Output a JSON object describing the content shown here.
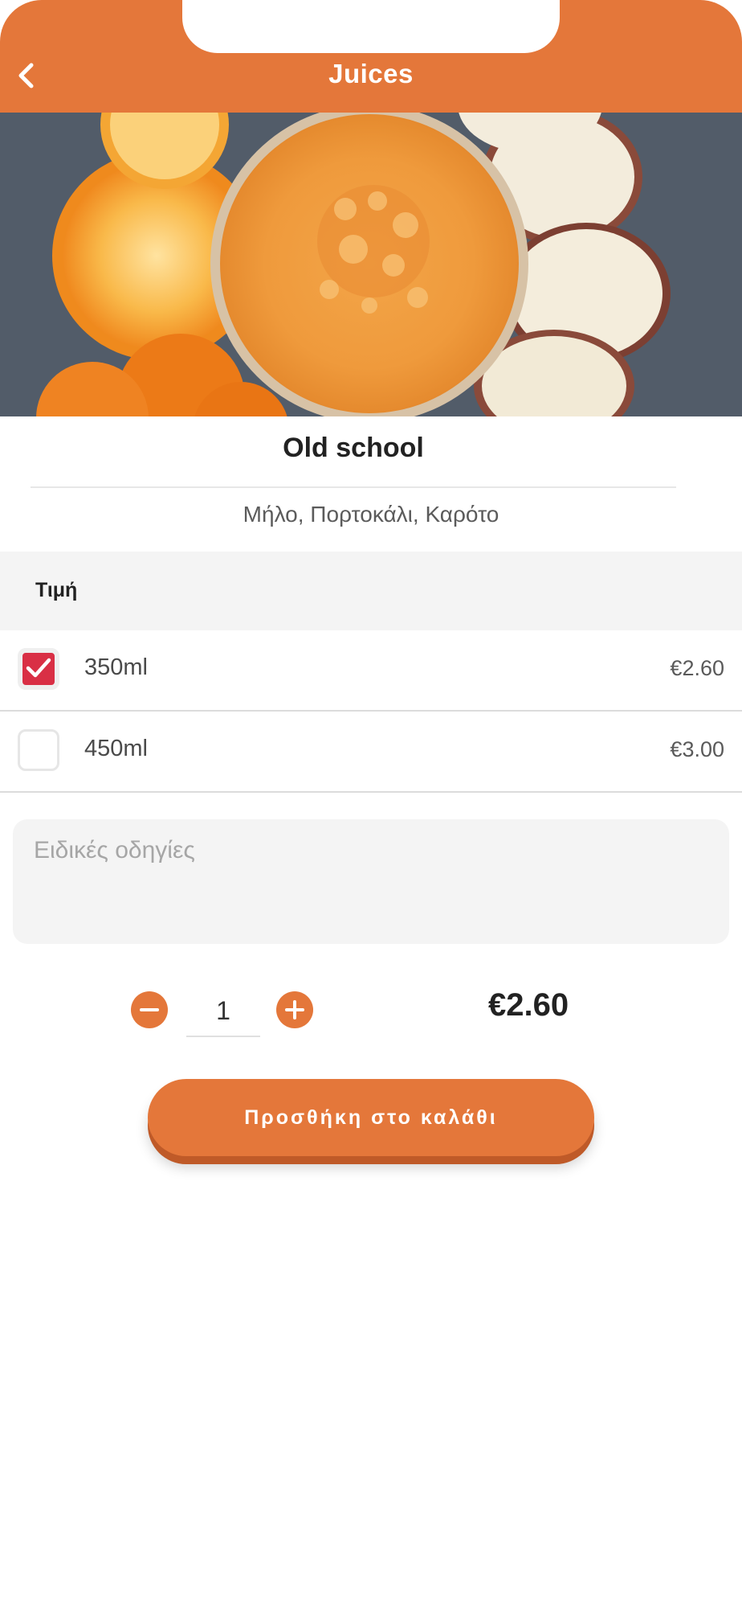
{
  "header": {
    "title": "Juices",
    "back_icon": "chevron-left-icon"
  },
  "hero": {
    "alt_subject": "orange juice glass with orange and apple slices"
  },
  "product": {
    "name": "Old school",
    "ingredients": "Μήλο, Πορτοκάλι, Καρότο"
  },
  "price_section": {
    "heading": "Τιμή",
    "options": [
      {
        "label": "350ml",
        "price": "€2.60",
        "checked": true
      },
      {
        "label": "450ml",
        "price": "€3.00",
        "checked": false
      }
    ]
  },
  "notes": {
    "placeholder": "Ειδικές οδηγίες"
  },
  "quantity": {
    "value": "1",
    "minus_icon": "minus-circle-icon",
    "plus_icon": "plus-circle-icon"
  },
  "total": "€2.60",
  "add_to_cart": {
    "label": "Προσθήκη στο καλάθι"
  },
  "colors": {
    "accent": "#e4773a",
    "checkbox_checked": "#d92f45"
  }
}
